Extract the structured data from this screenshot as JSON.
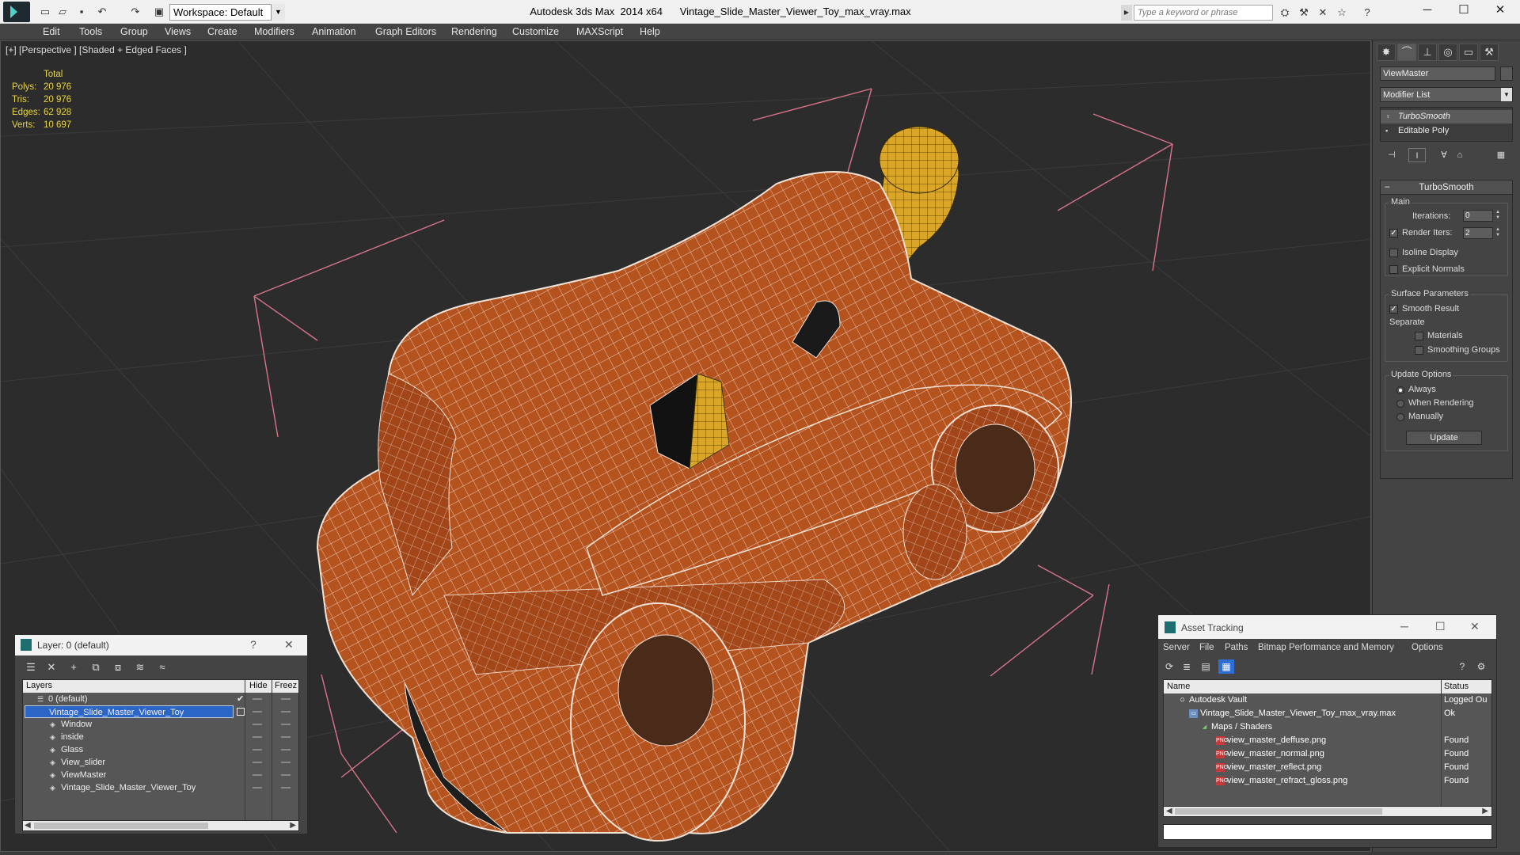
{
  "titlebar": {
    "workspace": "Workspace: Default",
    "app_title": "Autodesk 3ds Max  2014 x64",
    "file_title": "Vintage_Slide_Master_Viewer_Toy_max_vray.max",
    "search_placeholder": "Type a keyword or phrase"
  },
  "menu": [
    "Edit",
    "Tools",
    "Group",
    "Views",
    "Create",
    "Modifiers",
    "Animation",
    "Graph Editors",
    "Rendering",
    "Customize",
    "MAXScript",
    "Help"
  ],
  "viewport": {
    "label": "[+] [Perspective ] [Shaded + Edged Faces ]",
    "stats": {
      "header": "Total",
      "rows": [
        {
          "key": "Polys:",
          "value": "20 976"
        },
        {
          "key": "Tris:",
          "value": "20 976"
        },
        {
          "key": "Edges:",
          "value": "62 928"
        },
        {
          "key": "Verts:",
          "value": "10 697"
        }
      ]
    },
    "colors": {
      "model": "#b5531f",
      "wire": "#f4e2d6",
      "handle": "#d9a62a",
      "bbox": "#d9748a",
      "grid": "#3a3a3a",
      "background": "#2c2c2c"
    }
  },
  "command_panel": {
    "object_name": "ViewMaster",
    "modifier_list": "Modifier List",
    "stack": [
      "TurboSmooth",
      "Editable Poly"
    ],
    "rollout_title": "TurboSmooth",
    "main_group": "Main",
    "iterations_label": "Iterations:",
    "iterations_value": "0",
    "render_iters_label": "Render Iters:",
    "render_iters_value": "2",
    "render_iters_checked": true,
    "isoline_label": "Isoline Display",
    "explicit_normals_label": "Explicit Normals",
    "surface_group": "Surface Parameters",
    "smooth_result_label": "Smooth Result",
    "separate_label": "Separate",
    "materials_label": "Materials",
    "smoothing_groups_label": "Smoothing Groups",
    "update_group": "Update Options",
    "update_options": [
      "Always",
      "When Rendering",
      "Manually"
    ],
    "update_selected": "Always",
    "update_button": "Update"
  },
  "layer_panel": {
    "title": "Layer: 0 (default)",
    "help": "?",
    "col_layers": "Layers",
    "col_hide": "Hide",
    "col_freeze": "Freez",
    "rows": [
      {
        "name": "0 (default)",
        "indent": 1,
        "selected": false,
        "current": true
      },
      {
        "name": "Vintage_Slide_Master_Viewer_Toy",
        "indent": 1,
        "selected": true,
        "current": false
      },
      {
        "name": "Window",
        "indent": 2
      },
      {
        "name": "inside",
        "indent": 2
      },
      {
        "name": "Glass",
        "indent": 2
      },
      {
        "name": "View_slider",
        "indent": 2
      },
      {
        "name": "ViewMaster",
        "indent": 2
      },
      {
        "name": "Vintage_Slide_Master_Viewer_Toy",
        "indent": 2
      }
    ]
  },
  "asset_panel": {
    "title": "Asset Tracking",
    "menu": [
      "Server",
      "File",
      "Paths",
      "Bitmap Performance and Memory",
      "Options"
    ],
    "col_name": "Name",
    "col_status": "Status",
    "rows": [
      {
        "name": "Autodesk Vault",
        "status": "Logged Ou",
        "indent": 1,
        "icon": "vault-icon"
      },
      {
        "name": "Vintage_Slide_Master_Viewer_Toy_max_vray.max",
        "status": "Ok",
        "indent": 2,
        "icon": "max-file-icon"
      },
      {
        "name": "Maps / Shaders",
        "status": "",
        "indent": 3,
        "icon": "maps-icon"
      },
      {
        "name": "view_master_deffuse.png",
        "status": "Found",
        "indent": 4,
        "icon": "png-icon"
      },
      {
        "name": "view_master_normal.png",
        "status": "Found",
        "indent": 4,
        "icon": "png-icon"
      },
      {
        "name": "view_master_reflect.png",
        "status": "Found",
        "indent": 4,
        "icon": "png-icon"
      },
      {
        "name": "view_master_refract_gloss.png",
        "status": "Found",
        "indent": 4,
        "icon": "png-icon"
      }
    ]
  }
}
